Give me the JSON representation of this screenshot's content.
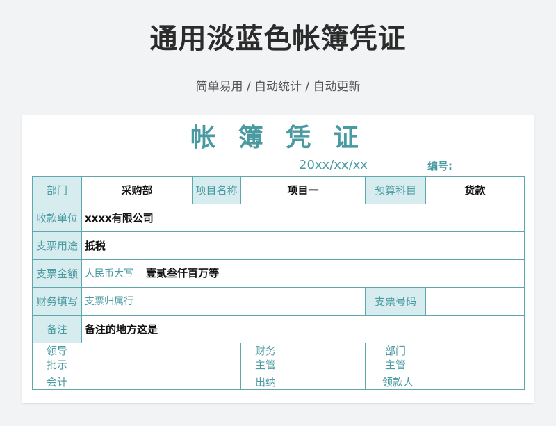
{
  "page": {
    "title": "通用淡蓝色帐簿凭证",
    "subtitle": "简单易用 / 自动统计 / 自动更新"
  },
  "voucher": {
    "title": "帐 簿 凭 证",
    "date": "20xx/xx/xx",
    "number_label": "编号:",
    "row1": {
      "dept_label": "部门",
      "dept_value": "采购部",
      "project_label": "项目名称",
      "project_value": "项目一",
      "budget_label": "预算科目",
      "budget_value": "货款"
    },
    "payee": {
      "label": "收款单位",
      "value": "xxxx有限公司"
    },
    "usage": {
      "label": "支票用途",
      "value": "抵税"
    },
    "amount": {
      "label": "支票金额",
      "hint": "人民币大写",
      "value": "壹贰叁仟百万等"
    },
    "finance": {
      "label": "财务填写",
      "hint": "支票归属行",
      "cheque_no_label": "支票号码"
    },
    "remark": {
      "label": "备注",
      "value": "备注的地方这是"
    },
    "approvals": {
      "leader": "领导\n批示",
      "finance_head": "财务\n主管",
      "dept_head": "部门\n主管"
    },
    "bottom": {
      "accounting": "会计",
      "cashier": "出纳",
      "receiver": "领款人"
    }
  },
  "colors": {
    "accent": "#4a9aa2",
    "border": "#5ea7ac",
    "label_bg": "#d6ecee",
    "page_bg": "#f1f3f5"
  }
}
